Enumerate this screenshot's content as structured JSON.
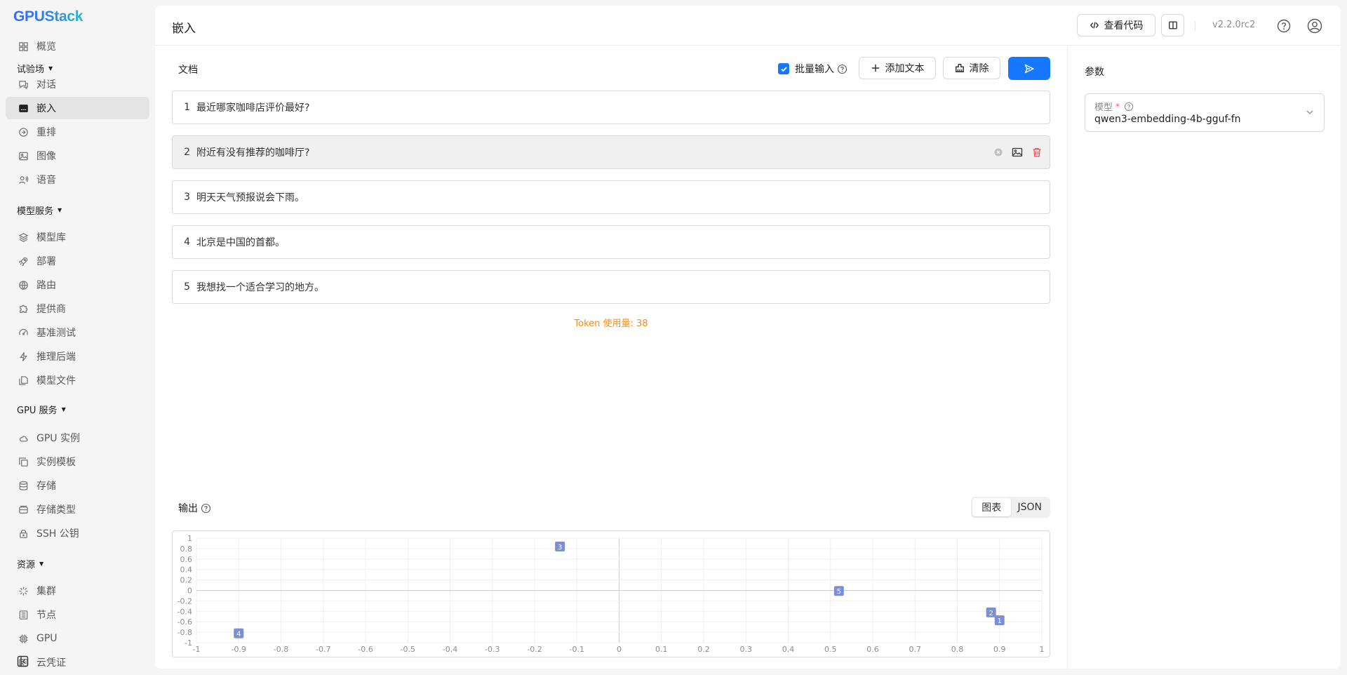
{
  "brand": {
    "logo_text": "GPUStack"
  },
  "sidebar": {
    "items": [
      {
        "label": "概览",
        "icon": "dashboard-icon"
      },
      {
        "label": "对话",
        "icon": "chat-icon"
      },
      {
        "label": "嵌入",
        "icon": "embedding-icon",
        "active": true
      },
      {
        "label": "重排",
        "icon": "rerank-icon"
      },
      {
        "label": "图像",
        "icon": "image-icon"
      },
      {
        "label": "语音",
        "icon": "audio-icon"
      },
      {
        "label": "模型库",
        "icon": "layers-icon"
      },
      {
        "label": "部署",
        "icon": "rocket-icon"
      },
      {
        "label": "路由",
        "icon": "globe-icon"
      },
      {
        "label": "提供商",
        "icon": "puzzle-icon"
      },
      {
        "label": "基准测试",
        "icon": "gauge-icon"
      },
      {
        "label": "推理后端",
        "icon": "bolt-icon"
      },
      {
        "label": "模型文件",
        "icon": "files-icon"
      },
      {
        "label": "GPU 实例",
        "icon": "cloud-icon"
      },
      {
        "label": "实例模板",
        "icon": "copy-icon"
      },
      {
        "label": "存储",
        "icon": "database-icon"
      },
      {
        "label": "存储类型",
        "icon": "storage-icon"
      },
      {
        "label": "SSH 公钥",
        "icon": "lock-icon"
      },
      {
        "label": "集群",
        "icon": "cluster-icon"
      },
      {
        "label": "节点",
        "icon": "node-icon"
      },
      {
        "label": "GPU",
        "icon": "chip-icon"
      },
      {
        "label": "云凭证",
        "icon": "credential-icon"
      }
    ],
    "groups": [
      "试验场",
      "模型服务",
      "GPU 服务",
      "资源"
    ]
  },
  "header": {
    "title": "嵌入",
    "view_code_label": "查看代码",
    "version": "v2.2.0rc2"
  },
  "documents": {
    "label": "文档",
    "batch_input_label": "批量输入",
    "batch_input_checked": true,
    "add_text_label": "添加文本",
    "clear_label": "清除",
    "rows": [
      {
        "num": "1",
        "text": "最近哪家咖啡店评价最好?"
      },
      {
        "num": "2",
        "text": "附近有没有推荐的咖啡厅?"
      },
      {
        "num": "3",
        "text": "明天天气预报说会下雨。"
      },
      {
        "num": "4",
        "text": "北京是中国的首都。"
      },
      {
        "num": "5",
        "text": "我想找一个适合学习的地方。"
      }
    ],
    "token_usage": "Token 使用量: 38"
  },
  "output": {
    "label": "输出",
    "tabs": [
      "图表",
      "JSON"
    ],
    "active_tab": "图表"
  },
  "params": {
    "title": "参数",
    "model_label": "模型",
    "model_value": "qwen3-embedding-4b-gguf-fn"
  },
  "colors": {
    "primary": "#1677ff",
    "point": "#7b8fd6",
    "token": "#fa8c16",
    "danger": "#ff4d4f"
  },
  "chart_data": {
    "type": "scatter",
    "xlim": [
      -1,
      1
    ],
    "ylim": [
      -1,
      1
    ],
    "x_ticks": [
      "-1",
      "-0.9",
      "-0.8",
      "-0.7",
      "-0.6",
      "-0.5",
      "-0.4",
      "-0.3",
      "-0.2",
      "-0.1",
      "0",
      "0.1",
      "0.2",
      "0.3",
      "0.4",
      "0.5",
      "0.6",
      "0.7",
      "0.8",
      "0.9",
      "1"
    ],
    "y_ticks": [
      "1",
      "0.8",
      "0.6",
      "0.4",
      "0.2",
      "0",
      "-0.2",
      "-0.4",
      "-0.6",
      "-0.8",
      "-1"
    ],
    "grid": true,
    "points": [
      {
        "label": "1",
        "x": 0.9,
        "y": -0.57
      },
      {
        "label": "2",
        "x": 0.88,
        "y": -0.42
      },
      {
        "label": "3",
        "x": -0.14,
        "y": 0.84
      },
      {
        "label": "4",
        "x": -0.9,
        "y": -0.82
      },
      {
        "label": "5",
        "x": 0.52,
        "y": -0.01
      }
    ]
  }
}
